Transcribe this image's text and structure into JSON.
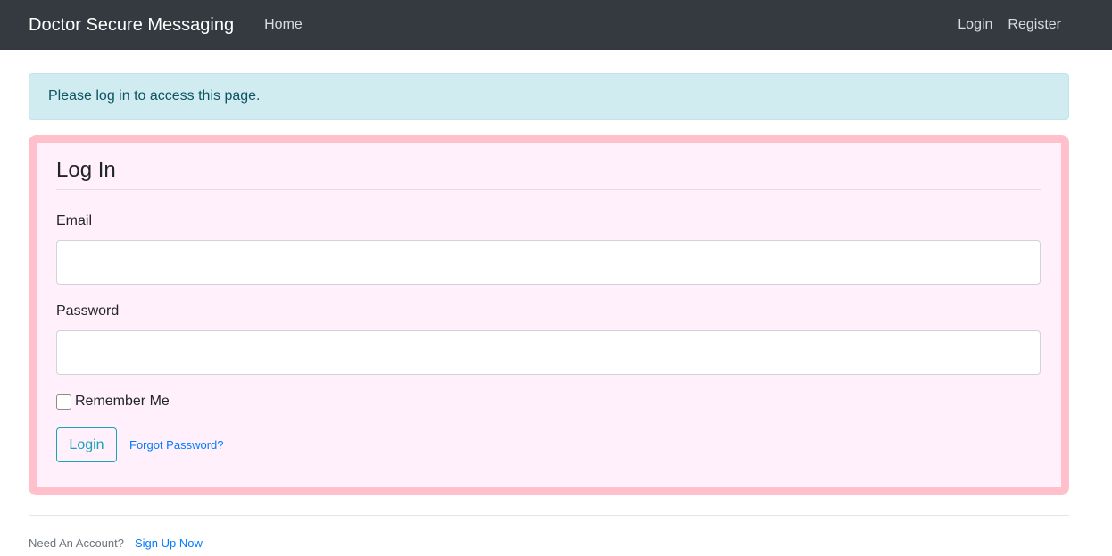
{
  "navbar": {
    "brand": "Doctor Secure Messaging",
    "home": "Home",
    "login": "Login",
    "register": "Register"
  },
  "alert": {
    "message": "Please log in to access this page."
  },
  "form": {
    "legend": "Log In",
    "email_label": "Email",
    "email_value": "",
    "password_label": "Password",
    "password_value": "",
    "remember_label": "Remember Me",
    "remember_checked": false,
    "submit_label": "Login",
    "forgot_label": "Forgot Password?"
  },
  "footer": {
    "prompt": "Need An Account?",
    "signup_label": "Sign Up Now"
  },
  "colors": {
    "navbar_bg": "#343a40",
    "alert_bg": "#d1ecf1",
    "box_border": "#ffc0cb",
    "box_bg": "#fff0fb",
    "button_outline": "#17a2b8",
    "link": "#007bff"
  }
}
